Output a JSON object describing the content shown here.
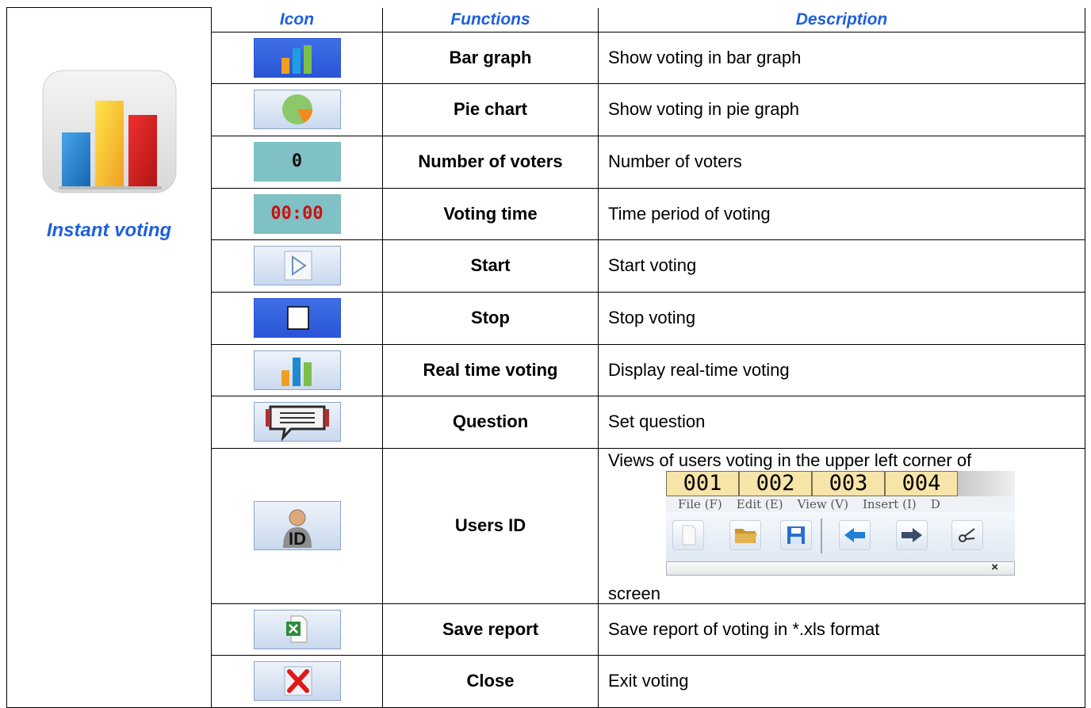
{
  "headers": {
    "icon": "Icon",
    "functions": "Functions",
    "description": "Description"
  },
  "section": {
    "label": "Instant voting",
    "icon": "instant-voting-bar-chart-icon"
  },
  "rows": [
    {
      "icon": "bar-graph-icon",
      "function": "Bar graph",
      "description": "Show voting in bar graph"
    },
    {
      "icon": "pie-chart-icon",
      "function": "Pie chart",
      "description": "Show voting in pie graph"
    },
    {
      "icon": "voter-count-icon",
      "icon_text": "0",
      "function": "Number of voters",
      "description": "Number of  voters"
    },
    {
      "icon": "voting-timer-icon",
      "icon_text": "00:00",
      "function": "Voting time",
      "description": "Time period of voting"
    },
    {
      "icon": "play-icon",
      "function": "Start",
      "description": "Start voting"
    },
    {
      "icon": "stop-icon",
      "function": "Stop",
      "description": "Stop voting"
    },
    {
      "icon": "realtime-bar-chart-icon",
      "function": "Real time voting",
      "description": "Display real-time voting"
    },
    {
      "icon": "speech-bubble-icon",
      "function": "Question",
      "description": "Set question"
    },
    {
      "icon": "user-id-icon",
      "icon_text": "ID",
      "function": "Users ID",
      "description_top": "Views of users voting in the upper left corner of",
      "description_bottom": "screen"
    },
    {
      "icon": "excel-file-icon",
      "function": "Save report",
      "description": "Save report of voting in *.xls format"
    },
    {
      "icon": "close-x-icon",
      "function": "Close",
      "description": "Exit voting"
    }
  ],
  "users_id_preview": {
    "ids": [
      "001",
      "002",
      "003",
      "004"
    ],
    "menu": [
      "File (F)",
      "Edit (E)",
      "View (V)",
      "Insert (I)",
      "D"
    ],
    "toolbar_icons": [
      "new-document-icon",
      "open-folder-icon",
      "save-floppy-icon",
      "back-arrow-icon",
      "forward-arrow-icon",
      "scissors-icon"
    ],
    "close_glyph": "×"
  },
  "colors": {
    "header_blue": "#1f5fdd",
    "icon_blue": "#2a55d6",
    "teal": "#7fc1c4",
    "timer_red": "#cc1111"
  }
}
